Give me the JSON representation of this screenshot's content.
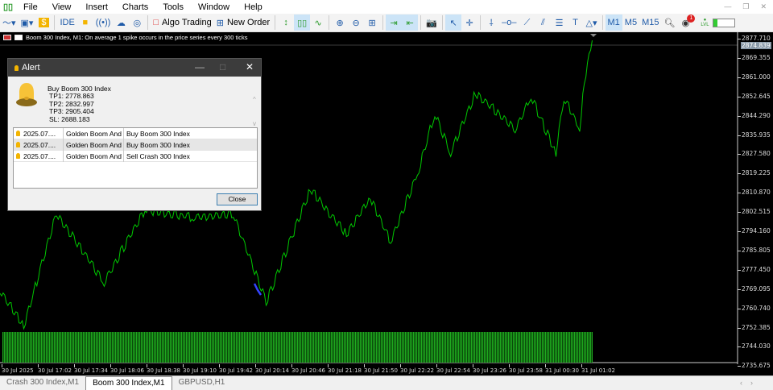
{
  "menu": [
    "File",
    "View",
    "Insert",
    "Charts",
    "Tools",
    "Window",
    "Help"
  ],
  "toolbar": {
    "ide": "IDE",
    "algo_trading": "Algo Trading",
    "new_order": "New Order",
    "tf": [
      "M1",
      "M5",
      "M15"
    ],
    "notif_count": "1",
    "lvl": "LVL"
  },
  "chart": {
    "title": "Boom 300 Index, M1:  On average 1 spike occurs in the price series every 300 ticks",
    "current_price": "2874.839",
    "line_color": "#00c800",
    "price_labels": [
      "2877.710",
      "2869.355",
      "2861.000",
      "2852.645",
      "2844.290",
      "2835.935",
      "2827.580",
      "2819.225",
      "2810.870",
      "2802.515",
      "2794.160",
      "2785.805",
      "2777.450",
      "2769.095",
      "2760.740",
      "2752.385",
      "2744.030",
      "2735.675"
    ],
    "time_labels": [
      "30 Jul 2025",
      "30 Jul 17:02",
      "30 Jul 17:34",
      "30 Jul 18:06",
      "30 Jul 18:38",
      "30 Jul 19:10",
      "30 Jul 19:42",
      "30 Jul 20:14",
      "30 Jul 20:46",
      "30 Jul 21:18",
      "30 Jul 21:50",
      "30 Jul 22:22",
      "30 Jul 22:54",
      "30 Jul 23:26",
      "30 Jul 23:58",
      "31 Jul 00:30",
      "31 Jul 01:02"
    ],
    "price_keypoints": [
      [
        0,
        2768.6
      ],
      [
        21,
        2752.9
      ],
      [
        50,
        2801.8
      ],
      [
        92,
        2772.1
      ],
      [
        128,
        2803.6
      ],
      [
        171,
        2800.1
      ],
      [
        206,
        2801.8
      ],
      [
        235,
        2763.4
      ],
      [
        274,
        2812.3
      ],
      [
        306,
        2793.1
      ],
      [
        327,
        2808.8
      ],
      [
        345,
        2789.6
      ],
      [
        370,
        2821.1
      ],
      [
        384,
        2845.5
      ],
      [
        398,
        2828.1
      ],
      [
        420,
        2854.3
      ],
      [
        455,
        2838.5
      ],
      [
        469,
        2852.5
      ],
      [
        491,
        2828.1
      ],
      [
        498,
        2852.5
      ],
      [
        512,
        2838.5
      ],
      [
        516,
        2859.5
      ],
      [
        523,
        2877.0
      ]
    ]
  },
  "tabs": [
    "Crash 300 Index,M1",
    "Boom 300 Index,M1",
    "GBPUSD,H1"
  ],
  "alert": {
    "title": "Alert",
    "message": "Buy Boom 300 Index",
    "tp1": "TP1: 2778.863",
    "tp2": "TP2: 2832.997",
    "tp3": "TP3: 2905.404",
    "sl": "SL: 2688.183",
    "rows": [
      {
        "time": "2025.07....",
        "source": "Golden Boom And ...",
        "text": "Buy Boom 300 Index"
      },
      {
        "time": "2025.07....",
        "source": "Golden Boom And ...",
        "text": "Buy Boom 300 Index"
      },
      {
        "time": "2025.07....",
        "source": "Golden Boom And ...",
        "text": "Sell Crash 300 Index"
      }
    ],
    "close_label": "Close"
  }
}
